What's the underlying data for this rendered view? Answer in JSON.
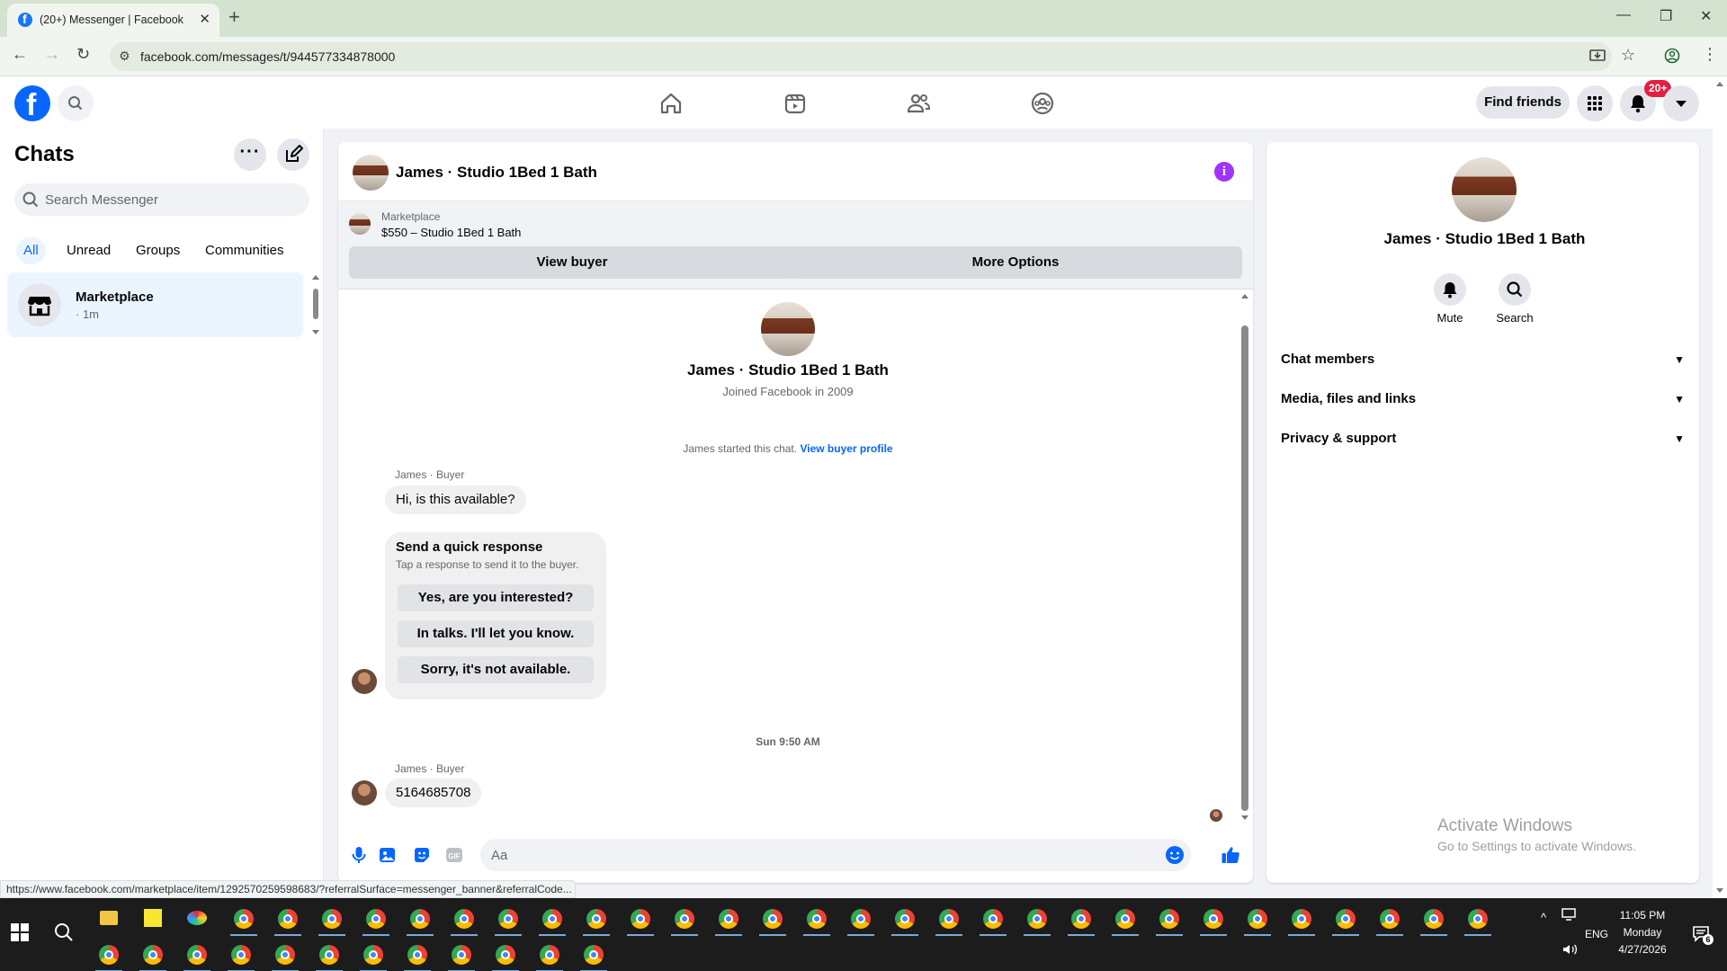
{
  "browser": {
    "tab_title": "(20+) Messenger | Facebook",
    "url": "facebook.com/messages/t/944577334878000",
    "status_url": "https://www.facebook.com/marketplace/item/1292570259598683/?referralSurface=messenger_banner&referralCode..."
  },
  "header": {
    "find_friends": "Find friends",
    "notifications_badge": "20+"
  },
  "sidebar": {
    "title": "Chats",
    "search_placeholder": "Search Messenger",
    "filters": [
      "All",
      "Unread",
      "Groups",
      "Communities"
    ],
    "chats": [
      {
        "name": "Marketplace",
        "time": "· 1m"
      }
    ]
  },
  "conversation": {
    "title": "James · Studio 1Bed 1 Bath",
    "banner": {
      "label": "Marketplace",
      "item": "$550 – Studio 1Bed 1 Bath",
      "view_buyer": "View buyer",
      "more_options": "More Options"
    },
    "profile": {
      "name": "James · Studio 1Bed 1 Bath",
      "joined": "Joined Facebook in 2009"
    },
    "started_text": "James started this chat.",
    "view_buyer_profile": "View buyer profile",
    "messages": [
      {
        "sender": "James · Buyer",
        "text": "Hi, is this available?"
      },
      {
        "sender": "James · Buyer",
        "text": "5164685708"
      }
    ],
    "quick_response": {
      "title": "Send a quick response",
      "subtitle": "Tap a response to send it to the buyer.",
      "options": [
        "Yes, are you interested?",
        "In talks. I'll let you know.",
        "Sorry, it's not available."
      ]
    },
    "timestamp": "Sun 9:50 AM",
    "composer_placeholder": "Aa"
  },
  "info_panel": {
    "name": "James · Studio 1Bed 1 Bath",
    "actions": [
      "Mute",
      "Search"
    ],
    "sections": [
      "Chat members",
      "Media, files and links",
      "Privacy & support"
    ]
  },
  "watermark": {
    "title": "Activate Windows",
    "subtitle": "Go to Settings to activate Windows."
  },
  "taskbar": {
    "time": "11:05 PM",
    "day": "Monday",
    "date": "4/27/2026",
    "lang": "ENG",
    "notif_count": "6"
  },
  "colors": {
    "facebook_blue": "#0866ff",
    "info_purple": "#a033ff",
    "badge_red": "#e41e3f"
  }
}
